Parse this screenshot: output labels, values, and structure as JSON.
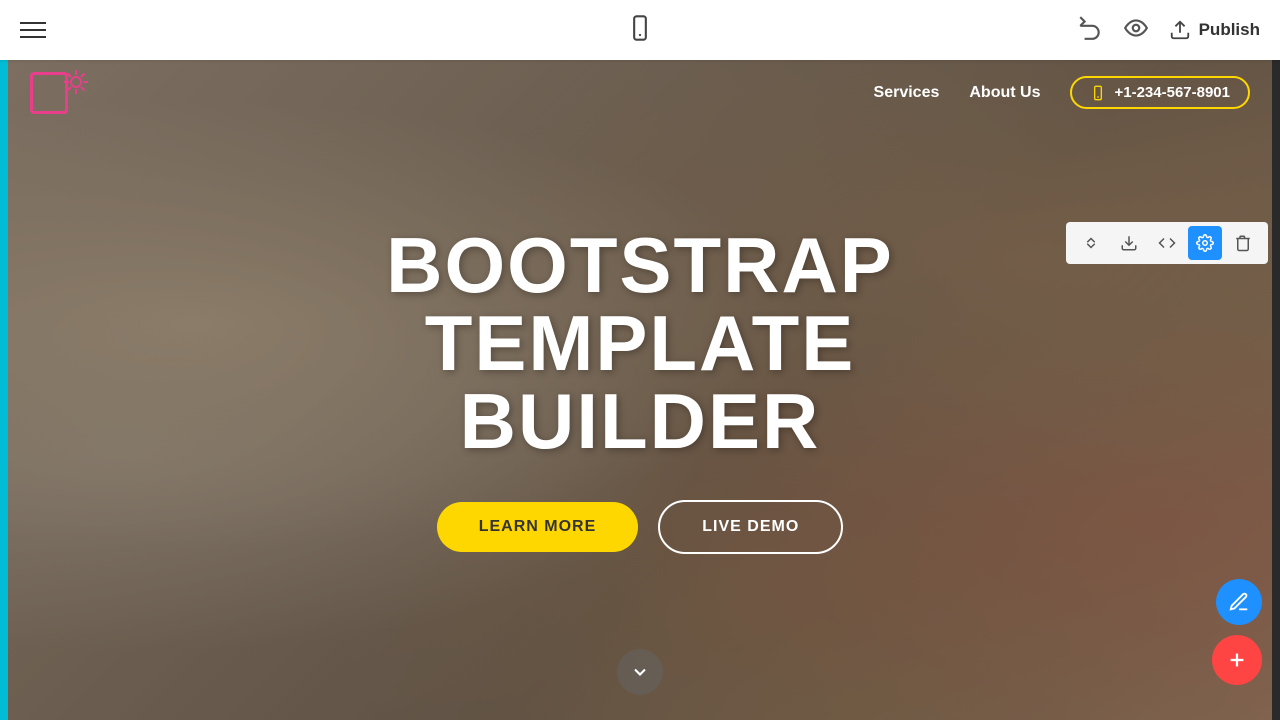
{
  "toolbar": {
    "publish_label": "Publish",
    "phone_icon_label": "mobile-view"
  },
  "nav": {
    "services_label": "Services",
    "about_label": "About Us",
    "phone_number": "+1-234-567-8901"
  },
  "section_tools": {
    "move": "↕",
    "download": "⬇",
    "code": "</>",
    "settings": "⚙",
    "delete": "🗑"
  },
  "hero": {
    "title_line1": "BOOTSTRAP",
    "title_line2": "TEMPLATE BUILDER",
    "btn_learn_more": "LEARN MORE",
    "btn_live_demo": "LIVE DEMO"
  },
  "fabs": {
    "edit_label": "Edit",
    "add_label": "Add"
  }
}
